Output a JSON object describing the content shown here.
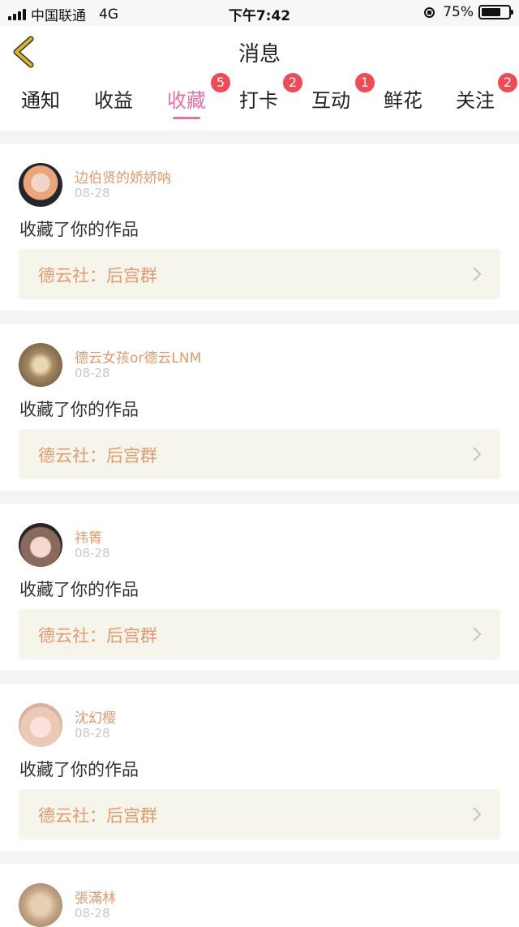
{
  "status_bar": {
    "carrier": "中国联通",
    "network": "4G",
    "time": "下午7:42",
    "battery": "75%",
    "battery_level": 0.75
  },
  "navbar": {
    "title": "消息",
    "back_icon": "chevron-left-icon"
  },
  "tabs": [
    {
      "label": "通知",
      "badge": ""
    },
    {
      "label": "收益",
      "badge": ""
    },
    {
      "label": "收藏",
      "badge": "5",
      "active": true
    },
    {
      "label": "打卡",
      "badge": "2"
    },
    {
      "label": "互动",
      "badge": "1"
    },
    {
      "label": "鲜花",
      "badge": ""
    },
    {
      "label": "关注",
      "badge": "2"
    }
  ],
  "colors": {
    "accent": "#e870a6",
    "name": "#e39a6c",
    "badge": "#f04a55",
    "card_box": "#f5f5ec",
    "back_icon": "#d8b526"
  },
  "messages": [
    {
      "name": "边伯贤的娇娇呐",
      "date": "08-28",
      "action": "收藏了你的作品",
      "work": "德云社：后宫群"
    },
    {
      "name": "德云女孩or德云LNM",
      "date": "08-28",
      "action": "收藏了你的作品",
      "work": "德云社：后宫群"
    },
    {
      "name": "祎箐",
      "date": "08-28",
      "action": "收藏了你的作品",
      "work": "德云社：后宫群"
    },
    {
      "name": "沈幻樱",
      "date": "08-28",
      "action": "收藏了你的作品",
      "work": "德云社：后宫群"
    },
    {
      "name": "張滿林",
      "date": "08-28",
      "action": "",
      "work": ""
    }
  ]
}
